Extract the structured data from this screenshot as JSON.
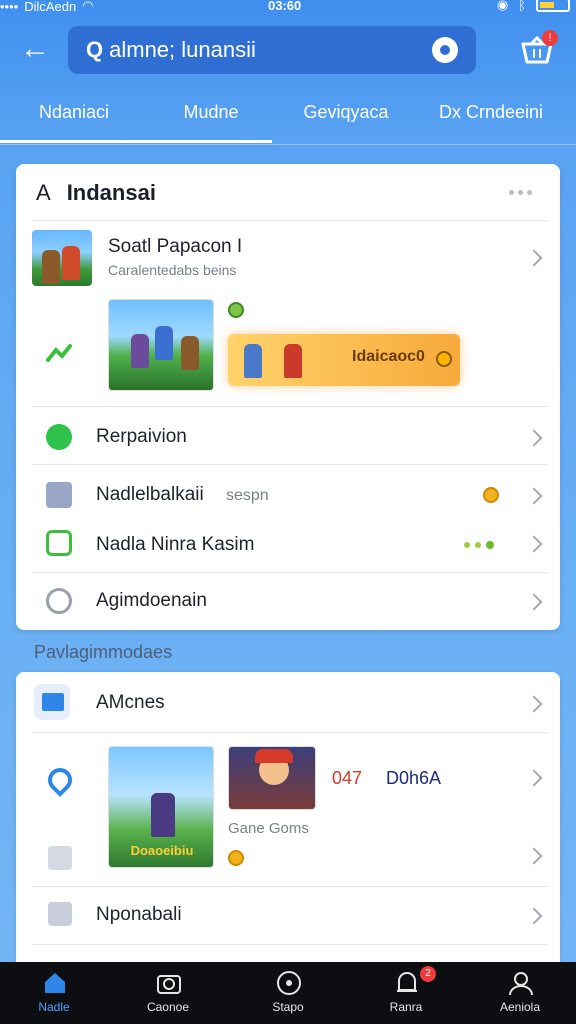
{
  "status_bar": {
    "carrier": "DilcAedn",
    "time": "03:60"
  },
  "header": {
    "search_text": "almne; lunansii",
    "cart_badge": "!"
  },
  "tabs": [
    {
      "label": "Ndaniaci"
    },
    {
      "label": "Mudne"
    },
    {
      "label": "Geviqyaca"
    },
    {
      "label": "Dx Crndeeini"
    }
  ],
  "card1": {
    "letter": "A",
    "title": "Indansai",
    "featured": {
      "title": "Soatl Papacon I",
      "subtitle": "Caralentedabs beins"
    },
    "promo_label": "Idaicaoc0",
    "rows": [
      {
        "label": "Rerpaivion"
      },
      {
        "label": "Nadlelbalkaii",
        "extra": "sespn"
      },
      {
        "label": "Nadla Ninra Kasim"
      },
      {
        "label": "Agimdoenain"
      }
    ]
  },
  "section_label": "Pavlagimmodaes",
  "card2": {
    "title": "AMcnes",
    "game_tile_title": "Doaoeibiu",
    "game_sub": "Gane Goms",
    "score_red": "047",
    "score_blue": "D0h6A",
    "bottom_row": "Nponabali"
  },
  "bottom_nav": [
    {
      "label": "Nadle",
      "active": true
    },
    {
      "label": "Caonoe"
    },
    {
      "label": "Stapo"
    },
    {
      "label": "Ranra",
      "badge": "2"
    },
    {
      "label": "Aeniola"
    }
  ],
  "colors": {
    "accent": "#3f8ff0",
    "nav_bg": "#0c0e12",
    "badge": "#ef3b3b"
  }
}
